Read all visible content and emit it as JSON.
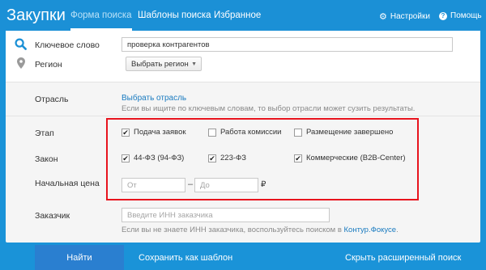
{
  "header": {
    "app_title": "Закупки",
    "tabs": [
      {
        "label": "Форма поиска",
        "active": true
      },
      {
        "label": "Шаблоны поиска",
        "active": false
      },
      {
        "label": "Избранное",
        "active": false
      }
    ],
    "settings_label": "Настройки",
    "help_label": "Помощь"
  },
  "search": {
    "keyword_label": "Ключевое слово",
    "keyword_value": "проверка контрагентов",
    "region_label": "Регион",
    "region_select": "Выбрать регион"
  },
  "industry": {
    "label": "Отрасль",
    "link": "Выбрать отрасль",
    "hint": "Если вы ищите по ключевым словам, то выбор отрасли может сузить результаты."
  },
  "stage": {
    "label": "Этап",
    "options": [
      {
        "label": "Подача заявок",
        "checked": true
      },
      {
        "label": "Работа комиссии",
        "checked": false
      },
      {
        "label": "Размещение завершено",
        "checked": false
      }
    ]
  },
  "law": {
    "label": "Закон",
    "options": [
      {
        "label": "44-ФЗ (94-ФЗ)",
        "checked": true
      },
      {
        "label": "223-ФЗ",
        "checked": true
      },
      {
        "label": "Коммерческие (B2B-Center)",
        "checked": true
      }
    ]
  },
  "price": {
    "label": "Начальная цена",
    "from_placeholder": "От",
    "dash": "–",
    "to_placeholder": "До",
    "currency": "₽"
  },
  "customer": {
    "label": "Заказчик",
    "placeholder": "Введите ИНН заказчика",
    "hint_prefix": "Если вы не знаете ИНН заказчика, воспользуйтесь поиском в ",
    "hint_link": "Контур.Фокусе",
    "hint_suffix": "."
  },
  "footer": {
    "find_button": "Найти",
    "save_template": "Сохранить как шаблон",
    "hide_advanced": "Скрыть расширенный поиск"
  },
  "colors": {
    "header_blue": "#1b90d6",
    "button_blue": "#2a7fd0",
    "highlight_red": "#e8141e",
    "link_blue": "#1a7bc0"
  }
}
